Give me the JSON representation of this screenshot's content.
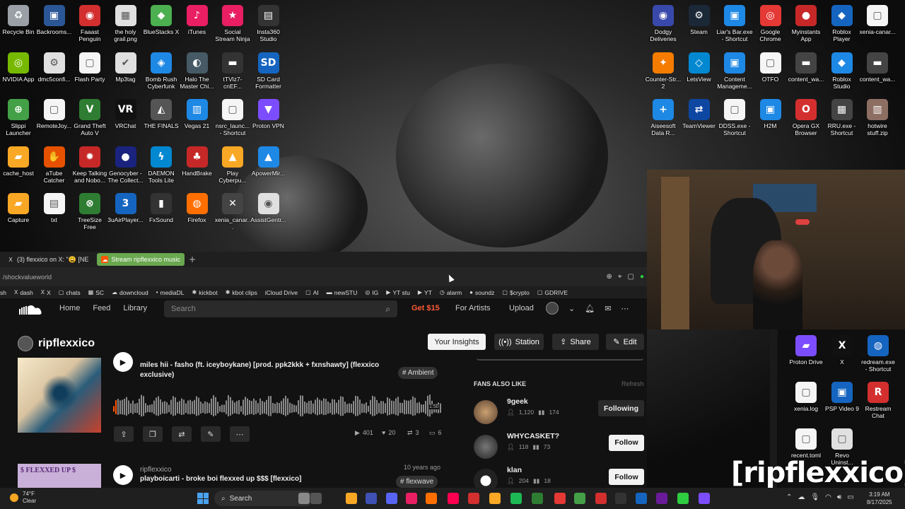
{
  "desktop": {
    "icons_left": [
      {
        "label": "Recycle Bin",
        "color": "#9aa0a6",
        "glyph": "♻"
      },
      {
        "label": "Backrooms...",
        "color": "#2b5797",
        "glyph": "▣"
      },
      {
        "label": "Faaast Penguin",
        "color": "#d32f2f",
        "glyph": "◉"
      },
      {
        "label": "the holy grail.png",
        "color": "#e0e0e0",
        "glyph": "▦"
      },
      {
        "label": "BlueStacks X",
        "color": "#4caf50",
        "glyph": "◆"
      },
      {
        "label": "iTunes",
        "color": "#e91e63",
        "glyph": "♪"
      },
      {
        "label": "Social Stream Ninja",
        "color": "#e91e63",
        "glyph": "★"
      },
      {
        "label": "Insta360 Studio",
        "color": "#333333",
        "glyph": "▤"
      },
      {
        "label": "NVIDIA App",
        "color": "#76b900",
        "glyph": "◎"
      },
      {
        "label": "dmc5confi...",
        "color": "#e0e0e0",
        "glyph": "⚙"
      },
      {
        "label": "Flash Party",
        "color": "#f5f5f5",
        "glyph": "▢"
      },
      {
        "label": "Mp3tag",
        "color": "#e0e0e0",
        "glyph": "✔"
      },
      {
        "label": "Bomb Rush Cyberfunk",
        "color": "#1e88e5",
        "glyph": "◈"
      },
      {
        "label": "Halo The Master Chi...",
        "color": "#455a64",
        "glyph": "◐"
      },
      {
        "label": "tTVlz7-cnEF...",
        "color": "#333333",
        "glyph": "▬"
      },
      {
        "label": "SD Card Formatter",
        "color": "#1565c0",
        "glyph": "SD"
      },
      {
        "label": "Slippi Launcher",
        "color": "#43a047",
        "glyph": "⊕"
      },
      {
        "label": "RemoteJoy...",
        "color": "#f5f5f5",
        "glyph": "▢"
      },
      {
        "label": "Grand Theft Auto V",
        "color": "#2e7d32",
        "glyph": "V"
      },
      {
        "label": "VRChat",
        "color": "#111111",
        "glyph": "VR"
      },
      {
        "label": "THE FINALS",
        "color": "#555555",
        "glyph": "◭"
      },
      {
        "label": "Vegas 21",
        "color": "#1e88e5",
        "glyph": "▥"
      },
      {
        "label": "nsrc_launc... - Shortcut",
        "color": "#f5f5f5",
        "glyph": "▢"
      },
      {
        "label": "Proton VPN",
        "color": "#7c4dff",
        "glyph": "▼"
      },
      {
        "label": "cache_host",
        "color": "#f9a825",
        "glyph": "▰"
      },
      {
        "label": "aTube Catcher",
        "color": "#e65100",
        "glyph": "✋"
      },
      {
        "label": "Keep Talking and Nobo...",
        "color": "#c62828",
        "glyph": "✹"
      },
      {
        "label": "Genocyber - The Collect...",
        "color": "#1a237e",
        "glyph": "●"
      },
      {
        "label": "DAEMON Tools Lite",
        "color": "#0288d1",
        "glyph": "ϟ"
      },
      {
        "label": "HandBrake",
        "color": "#c62828",
        "glyph": "♣"
      },
      {
        "label": "Play Cyberpu...",
        "color": "#f9a825",
        "glyph": "▲"
      },
      {
        "label": "ApowerMir...",
        "color": "#1e88e5",
        "glyph": "▲"
      },
      {
        "label": "Capture",
        "color": "#f9a825",
        "glyph": "▰"
      },
      {
        "label": "txt",
        "color": "#f5f5f5",
        "glyph": "▤"
      },
      {
        "label": "TreeSize Free",
        "color": "#2e7d32",
        "glyph": "⊗"
      },
      {
        "label": "3uAirPlayer...",
        "color": "#1565c0",
        "glyph": "3"
      },
      {
        "label": "FxSound",
        "color": "#333333",
        "glyph": "▮"
      },
      {
        "label": "Firefox",
        "color": "#ff6f00",
        "glyph": "◍"
      },
      {
        "label": "xenia_canar...",
        "color": "#444444",
        "glyph": "✕"
      },
      {
        "label": "AssistGentr...",
        "color": "#e0e0e0",
        "glyph": "◉"
      }
    ],
    "icons_right": [
      {
        "label": "Dodgy Deliveries",
        "color": "#3949ab",
        "glyph": "◉"
      },
      {
        "label": "Steam",
        "color": "#1b2838",
        "glyph": "⚙"
      },
      {
        "label": "Liar's Bar.exe - Shortcut",
        "color": "#1e88e5",
        "glyph": "▣"
      },
      {
        "label": "Google Chrome",
        "color": "#e53935",
        "glyph": "◎"
      },
      {
        "label": "Myinstants App",
        "color": "#c62828",
        "glyph": "●"
      },
      {
        "label": "Roblox Player",
        "color": "#1565c0",
        "glyph": "◆"
      },
      {
        "label": "xenia-canar...",
        "color": "#f5f5f5",
        "glyph": "▢"
      },
      {
        "label": "Counter-Str... 2",
        "color": "#f57c00",
        "glyph": "✦"
      },
      {
        "label": "LetsView",
        "color": "#0288d1",
        "glyph": "◇"
      },
      {
        "label": "Content Manageme...",
        "color": "#1e88e5",
        "glyph": "▣"
      },
      {
        "label": "OTFO",
        "color": "#f5f5f5",
        "glyph": "▢"
      },
      {
        "label": "content_wa...",
        "color": "#444444",
        "glyph": "▬"
      },
      {
        "label": "Roblox Studio",
        "color": "#1e88e5",
        "glyph": "◆"
      },
      {
        "label": "content_wa...",
        "color": "#444444",
        "glyph": "▬"
      },
      {
        "label": "Aiseesoft Data R...",
        "color": "#1e88e5",
        "glyph": "+"
      },
      {
        "label": "TeamViewer",
        "color": "#0d47a1",
        "glyph": "⇄"
      },
      {
        "label": "DDSS.exe - Shortcut",
        "color": "#f5f5f5",
        "glyph": "▢"
      },
      {
        "label": "H2M",
        "color": "#1e88e5",
        "glyph": "▣"
      },
      {
        "label": "Opera GX Browser",
        "color": "#d32f2f",
        "glyph": "O"
      },
      {
        "label": "RRU.exe - Shortcut",
        "color": "#444444",
        "glyph": "▦"
      },
      {
        "label": "hotwire stuff.zip",
        "color": "#8d6e63",
        "glyph": "▥"
      }
    ],
    "icons_bottom_right": [
      {
        "label": "Proton Drive",
        "color": "#7c4dff",
        "glyph": "▰"
      },
      {
        "label": "X",
        "color": "#111111",
        "glyph": "X"
      },
      {
        "label": "redream.exe - Shortcut",
        "color": "#1565c0",
        "glyph": "◍"
      },
      {
        "label": "xenia.log",
        "color": "#f5f5f5",
        "glyph": "▢"
      },
      {
        "label": "PSP Video 9",
        "color": "#1565c0",
        "glyph": "▣"
      },
      {
        "label": "Restream Chat",
        "color": "#d32f2f",
        "glyph": "R"
      },
      {
        "label": "recent.toml",
        "color": "#f5f5f5",
        "glyph": "▢"
      },
      {
        "label": "Revo Uninst...",
        "color": "#e0e0e0",
        "glyph": "▢"
      }
    ]
  },
  "browser": {
    "tabs": [
      {
        "label": "(3) flexxico on X: \"😩 [NE",
        "icon": "X",
        "active": false
      },
      {
        "label": "Stream ripflexxico music",
        "icon": "☁",
        "active": true
      }
    ],
    "new_tab": "+",
    "url": "/shockvalueworld",
    "bookmarks": [
      {
        "label": "sh",
        "icon": ""
      },
      {
        "label": "dash",
        "icon": "X"
      },
      {
        "label": "X",
        "icon": "X"
      },
      {
        "label": "chats",
        "icon": "▢"
      },
      {
        "label": "SC",
        "icon": "▦"
      },
      {
        "label": "downcloud",
        "icon": "☁"
      },
      {
        "label": "mediaDL",
        "icon": "•"
      },
      {
        "label": "kickbot",
        "icon": "✱"
      },
      {
        "label": "kbot clips",
        "icon": "✱"
      },
      {
        "label": "iCloud Drive",
        "icon": ""
      },
      {
        "label": "AI",
        "icon": "▢"
      },
      {
        "label": "newSTU",
        "icon": "▬"
      },
      {
        "label": "IG",
        "icon": "◎"
      },
      {
        "label": "YT stu",
        "icon": "▶"
      },
      {
        "label": "YT",
        "icon": "▶"
      },
      {
        "label": "alarm",
        "icon": "◷"
      },
      {
        "label": "soundz",
        "icon": "●"
      },
      {
        "label": "$crypto",
        "icon": "▢"
      },
      {
        "label": "GDRIVE",
        "icon": "▢"
      }
    ]
  },
  "soundcloud": {
    "nav": {
      "home": "Home",
      "feed": "Feed",
      "library": "Library"
    },
    "search_placeholder": "Search",
    "get_offer": "Get $15",
    "for_artists": "For Artists",
    "upload": "Upload",
    "profile": {
      "name": "ripflexxico",
      "buttons": {
        "insights": "Your Insights",
        "station": "Station",
        "share": "Share",
        "edit": "Edit"
      }
    },
    "tracks": [
      {
        "title": "miles hii - fasho (ft. iceyboykane) [prod. ppk2kkk + fxnshawty] (flexxico exclusive)",
        "tag": "# Ambient",
        "duration": "1:50",
        "stats": {
          "plays": "401",
          "likes": "20",
          "reposts": "3",
          "comments": "6"
        }
      },
      {
        "user": "ripflexxico",
        "title": "playboicarti - broke boi flexxed up $$$ [flexxico]",
        "tag": "# flexwave",
        "date": "10 years ago",
        "art_text": "$ FLEXXED UP $"
      }
    ],
    "fans_also_like": {
      "heading": "FANS ALSO LIKE",
      "refresh": "Refresh",
      "users": [
        {
          "name": "9geek",
          "followers": "1,120",
          "tracks": "174",
          "button": "Following",
          "following": true
        },
        {
          "name": "WHYCASKET?",
          "followers": "118",
          "tracks": "73",
          "button": "Follow",
          "following": false
        },
        {
          "name": "klan",
          "followers": "204",
          "tracks": "18",
          "button": "Follow",
          "following": false
        }
      ]
    }
  },
  "overlay": {
    "watermark": "[ripflexxico]"
  },
  "taskbar": {
    "weather_temp": "74°F",
    "weather_desc": "Clear",
    "search_label": "Search",
    "time": "3:19 AM",
    "date": "8/17/2025"
  }
}
